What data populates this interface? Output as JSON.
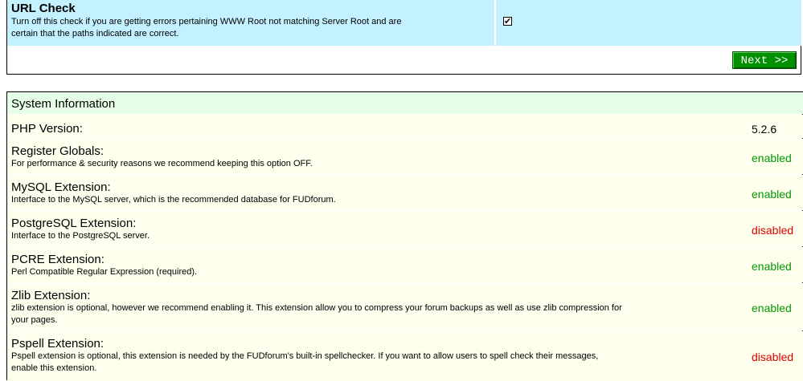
{
  "url_check": {
    "title": "URL Check",
    "description_line1": "Turn off this check if you are getting errors pertaining WWW Root not matching Server Root and are",
    "description_line2": "certain that the paths indicated are correct.",
    "checked_mark": "✔"
  },
  "next_button": {
    "label": "Next >>"
  },
  "system_info": {
    "header": "System Information",
    "rows": [
      {
        "title": "PHP Version:",
        "desc": "",
        "desc2": "",
        "status": "5.2.6"
      },
      {
        "title": "Register Globals:",
        "desc": "For performance & security reasons we recommend keeping this option OFF.",
        "desc2": "",
        "status": "enabled"
      },
      {
        "title": "MySQL Extension:",
        "desc": "Interface to the MySQL server, which is the recommended database for FUDforum.",
        "desc2": "",
        "status": "enabled"
      },
      {
        "title": "PostgreSQL Extension:",
        "desc": "Interface to the PostgreSQL server.",
        "desc2": "",
        "status": "disabled"
      },
      {
        "title": "PCRE Extension:",
        "desc": "Perl Compatible Regular Expression (required).",
        "desc2": "",
        "status": "enabled"
      },
      {
        "title": "Zlib Extension:",
        "desc": "zlib extension is optional, however we recommend enabling it. This extension allow you to compress your forum backups as well as use zlib compression for",
        "desc2": "your pages.",
        "status": "enabled"
      },
      {
        "title": "Pspell Extension:",
        "desc": "Pspell extension is optional, this extension is needed by the FUDforum's built-in spellchecker. If you want to allow users to spell check their messages,",
        "desc2": "enable this extension.",
        "status": "disabled"
      }
    ]
  },
  "colors": {
    "url_row_bg": "#c4f1ff",
    "sys_header_bg": "#e6ffe6",
    "row_bg": "#ffffee",
    "enabled": "#009900",
    "disabled": "#dd0000",
    "button_bg": "#009000"
  }
}
